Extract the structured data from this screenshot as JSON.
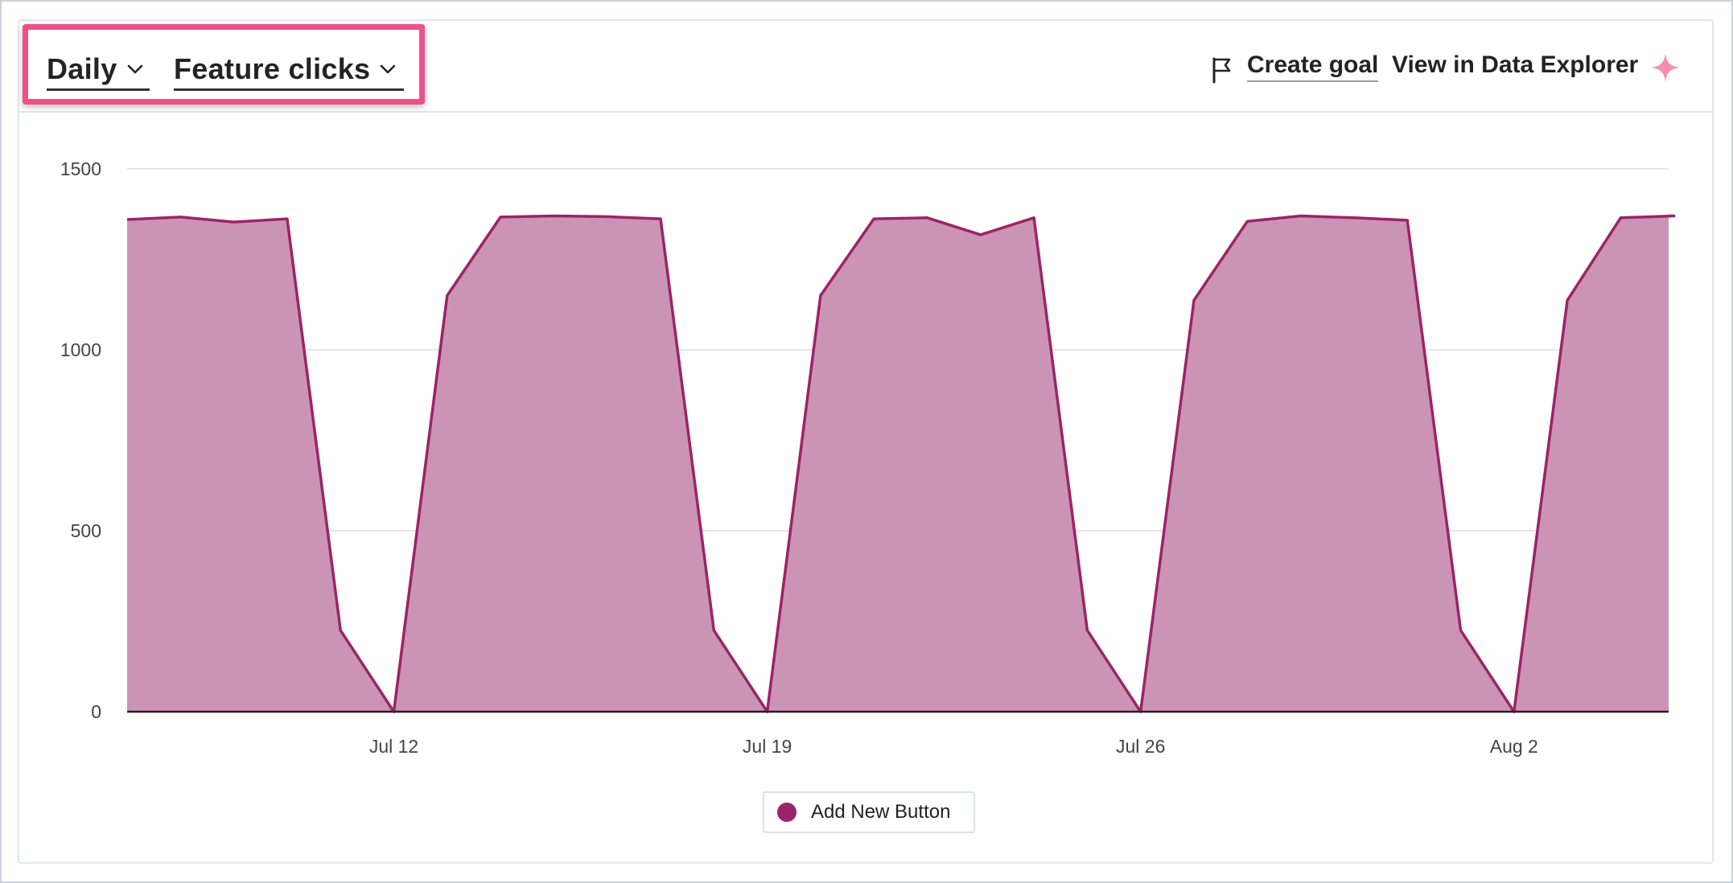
{
  "header": {
    "period_label": "Daily",
    "metric_label": "Feature clicks",
    "create_goal_label": "Create goal",
    "view_explorer_label": "View in Data Explorer",
    "icons": [
      "chevron-down-icon",
      "flag-icon",
      "sparkle-icon"
    ]
  },
  "colors": {
    "series": "#9b2468",
    "fill": "#cc94b4",
    "highlight": "#ee4f8c",
    "sparkle": "#f48fb1"
  },
  "legend": {
    "label": "Add New Button"
  },
  "chart_data": {
    "type": "area",
    "title": "",
    "xlabel": "",
    "ylabel": "",
    "ylim": [
      0,
      1500
    ],
    "y_ticks": [
      0,
      500,
      1000,
      1500
    ],
    "x_tick_labels": [
      "Jul 12",
      "Jul 19",
      "Jul 26",
      "Aug 2"
    ],
    "grid": true,
    "legend_position": "bottom-center",
    "series": [
      {
        "name": "Add New Button",
        "x": [
          "Jul 7",
          "Jul 8",
          "Jul 9",
          "Jul 10",
          "Jul 11",
          "Jul 12",
          "Jul 13",
          "Jul 14",
          "Jul 15",
          "Jul 16",
          "Jul 17",
          "Jul 18",
          "Jul 19",
          "Jul 20",
          "Jul 21",
          "Jul 22",
          "Jul 23",
          "Jul 24",
          "Jul 25",
          "Jul 26",
          "Jul 27",
          "Jul 28",
          "Jul 29",
          "Jul 30",
          "Jul 31",
          "Aug 1",
          "Aug 2",
          "Aug 3",
          "Aug 4",
          "Aug 5"
        ],
        "values": [
          1360,
          1367,
          1353,
          1362,
          225,
          0,
          1150,
          1367,
          1370,
          1368,
          1362,
          225,
          0,
          1150,
          1362,
          1365,
          1318,
          1365,
          225,
          0,
          1137,
          1355,
          1370,
          1365,
          1358,
          225,
          0,
          1137,
          1365,
          1370
        ]
      }
    ]
  }
}
